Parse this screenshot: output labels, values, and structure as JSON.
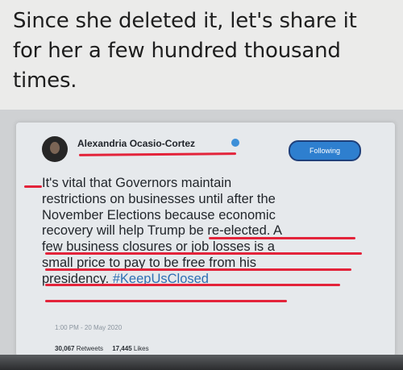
{
  "caption": {
    "line1": "Since she deleted it, let's share it",
    "line2": "for her a few hundred thousand",
    "line3": "times."
  },
  "tweet": {
    "author_name": "Alexandria Ocasio-Cortez",
    "follow_label": "Following",
    "text_lines": [
      "It's vital that Governors maintain",
      "restrictions on businesses until after the",
      "November Elections because economic",
      "recovery will help Trump be re-elected. A",
      "few business closures or job losses is a",
      "small price to pay to be free from his",
      "presidency."
    ],
    "hashtag": "#KeepUsClosed",
    "timestamp": "1:00 PM - 20 May 2020",
    "retweets_count": "30,067",
    "retweets_label": "Retweets",
    "likes_count": "17,445",
    "likes_label": "Likes"
  },
  "colors": {
    "marker": "#e3233a",
    "follow_button": "#2e7fcf",
    "hashtag": "#2f6fb3"
  }
}
